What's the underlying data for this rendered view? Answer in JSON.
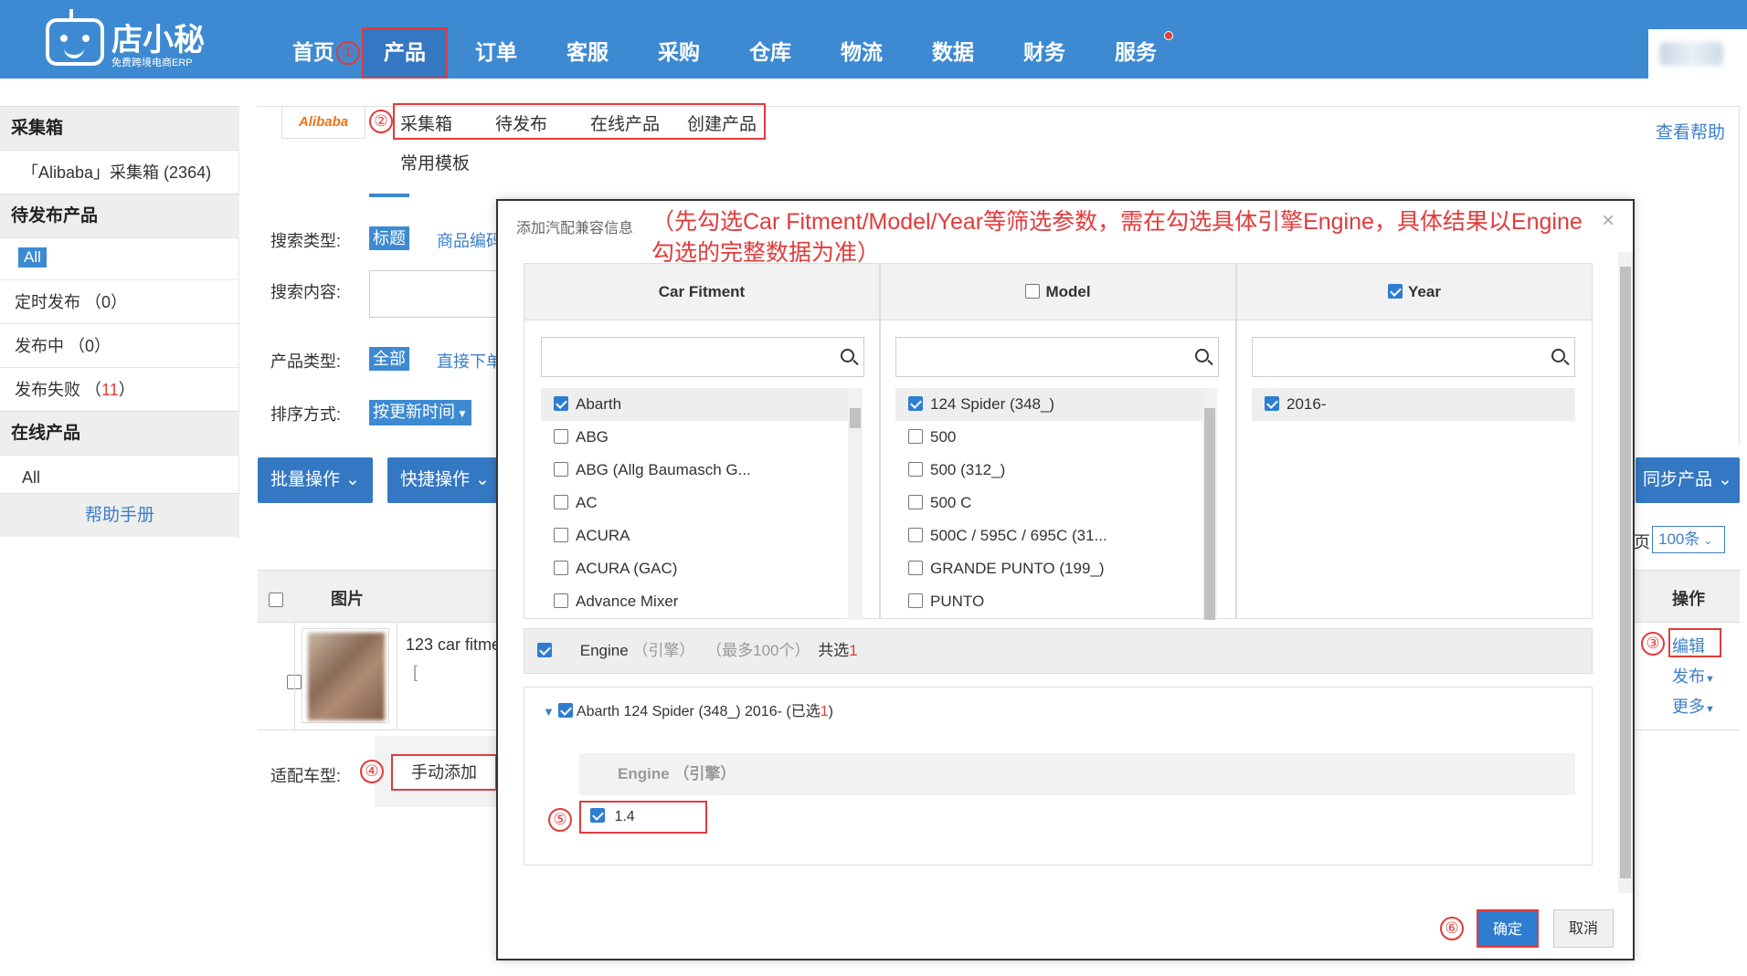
{
  "app": {
    "logo_name": "店小秘",
    "logo_sub": "免费跨境电商ERP"
  },
  "nav": {
    "items": [
      "首页",
      "产品",
      "订单",
      "客服",
      "采购",
      "仓库",
      "物流",
      "数据",
      "财务",
      "服务"
    ],
    "active": "产品",
    "step1": "①"
  },
  "subnav": {
    "source": "Alibaba",
    "step2": "②",
    "tabs": [
      "采集箱",
      "待发布",
      "在线产品",
      "创建产品"
    ],
    "templates": "常用模板",
    "help": "查看帮助"
  },
  "sidebar": {
    "section1": "采集箱",
    "collect_item": "「Alibaba」采集箱 (2364)",
    "section2": "待发布产品",
    "all1": "All",
    "scheduled": "定时发布 （0）",
    "publishing": "发布中 （0）",
    "failed_label": "发布失败 （",
    "failed_count": "11",
    "failed_close": "）",
    "section3": "在线产品",
    "all2": "All",
    "help": "帮助手册"
  },
  "filters": {
    "search_type_label": "搜索类型:",
    "search_type_value": "标题",
    "search_type_alt": "商品编码",
    "search_content_label": "搜索内容:",
    "product_type_label": "产品类型:",
    "product_type_value": "全部",
    "product_type_alt": "直接下单",
    "sort_label": "排序方式:",
    "sort_value": "按更新时间"
  },
  "actions": {
    "batch": "批量操作",
    "quick": "快捷操作",
    "sync": "同步产品",
    "page_size": "100条",
    "page_prefix": "页"
  },
  "table": {
    "col_image": "图片",
    "col_ops": "操作",
    "row_title": "123 car fitme",
    "row_sub": "[",
    "edit": "编辑",
    "publish": "发布",
    "more": "更多",
    "step3": "③"
  },
  "fitment": {
    "label": "适配车型:",
    "step4": "④",
    "button": "手动添加"
  },
  "modal": {
    "title": "添加汽配兼容信息",
    "note": "（先勾选Car Fitment/Model/Year等筛选参数，需在勾选具体引擎Engine，具体结果以Engine勾选的完整数据为准）",
    "close": "×",
    "col1_title": "Car Fitment",
    "col2_title": "Model",
    "col3_title": "Year",
    "col1_options": [
      {
        "label": "Abarth",
        "checked": true
      },
      {
        "label": "ABG",
        "checked": false
      },
      {
        "label": "ABG (Allg Baumasch G...",
        "checked": false
      },
      {
        "label": "AC",
        "checked": false
      },
      {
        "label": "ACURA",
        "checked": false
      },
      {
        "label": "ACURA (GAC)",
        "checked": false
      },
      {
        "label": "Advance Mixer",
        "checked": false
      }
    ],
    "col2_options": [
      {
        "label": "124 Spider (348_)",
        "checked": true
      },
      {
        "label": "500",
        "checked": false
      },
      {
        "label": "500 (312_)",
        "checked": false
      },
      {
        "label": "500 C",
        "checked": false
      },
      {
        "label": "500C / 595C / 695C (31...",
        "checked": false
      },
      {
        "label": "GRANDE PUNTO (199_)",
        "checked": false
      },
      {
        "label": "PUNTO",
        "checked": false
      }
    ],
    "col3_options": [
      {
        "label": "2016-",
        "checked": true
      }
    ],
    "engine_label": "Engine",
    "engine_cn": "（引擎）",
    "engine_max": "（最多100个）",
    "engine_total_label": "共选",
    "engine_total": "1",
    "result_path": "Abarth   124 Spider (348_)   2016-  (已选",
    "result_count": "1",
    "result_close": ")",
    "engine_head": "Engine  （引擎）",
    "engine_value": "1.4",
    "step5": "⑤",
    "step6": "⑥",
    "ok": "确定",
    "cancel": "取消"
  }
}
